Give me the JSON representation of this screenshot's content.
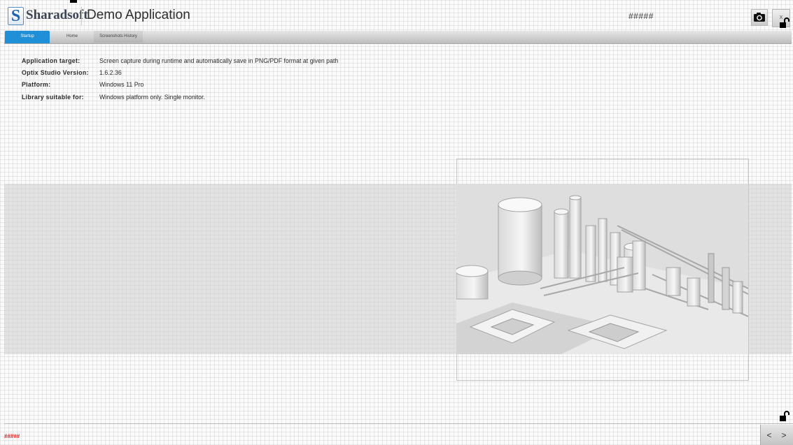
{
  "header": {
    "logo_letter": "S",
    "brand": "Sharadsoft",
    "title": "Demo Application",
    "status": "#####",
    "close_label": "x"
  },
  "tabs": [
    {
      "label": "Startup",
      "active": true
    },
    {
      "label": "Home",
      "active": false
    },
    {
      "label": "Screenshots History",
      "active": false
    }
  ],
  "info": [
    {
      "label": "Application target:",
      "value": "Screen capture during runtime and automatically save in PNG/PDF format at given path"
    },
    {
      "label": "Optix Studio Version:",
      "value": "1.6.2.36"
    },
    {
      "label": "Platform:",
      "value": "Windows 11 Pro"
    },
    {
      "label": "Library suitable for:",
      "value": "Windows platform only. Single monitor."
    }
  ],
  "footer": {
    "status": "#####",
    "prev_label": "<",
    "next_label": ">"
  },
  "colors": {
    "accent": "#1f8fd8",
    "footer_status": "#dd2222"
  },
  "icons": {
    "camera": "camera-icon",
    "lock": "padlock-open-icon"
  }
}
